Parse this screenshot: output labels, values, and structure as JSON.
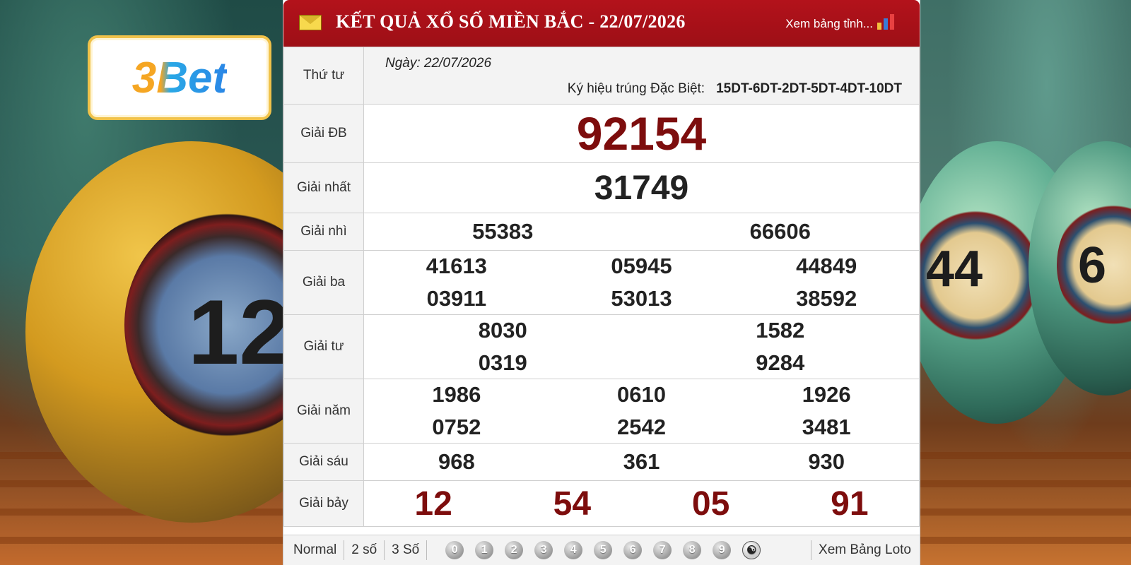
{
  "brand": {
    "logo_text": "3Bet"
  },
  "background": {
    "ball_left_number": "12",
    "ball_right_numbers": [
      "44",
      "6"
    ]
  },
  "header": {
    "title": "KẾT QUẢ XỔ SỐ MIỀN BẮC - 22/07/2026",
    "link_text": "Xem bảng tỉnh...",
    "accent_color": "#B3121B"
  },
  "info": {
    "weekday": "Thứ tư",
    "date_label": "Ngày: 22/07/2026",
    "kyhieu_label": "Ký hiệu trúng Đặc Biệt:",
    "kyhieu_value": "15DT-6DT-2DT-5DT-4DT-10DT"
  },
  "prizes": {
    "db": {
      "label": "Giải ĐB",
      "value": "92154"
    },
    "nhat": {
      "label": "Giải nhất",
      "value": "31749"
    },
    "nhi": {
      "label": "Giải nhì",
      "values": [
        "55383",
        "66606"
      ]
    },
    "ba": {
      "label": "Giải ba",
      "values": [
        "41613",
        "05945",
        "44849",
        "03911",
        "53013",
        "38592"
      ]
    },
    "tu": {
      "label": "Giải tư",
      "values": [
        "8030",
        "1582",
        "0319",
        "9284"
      ]
    },
    "nam": {
      "label": "Giải năm",
      "values": [
        "1986",
        "0610",
        "1926",
        "0752",
        "2542",
        "3481"
      ]
    },
    "sau": {
      "label": "Giải sáu",
      "values": [
        "968",
        "361",
        "930"
      ]
    },
    "bay": {
      "label": "Giải bảy",
      "values": [
        "12",
        "54",
        "05",
        "91"
      ]
    }
  },
  "footer": {
    "tabs": [
      "Normal",
      "2 số",
      "3 Số"
    ],
    "digits": [
      "0",
      "1",
      "2",
      "3",
      "4",
      "5",
      "6",
      "7",
      "8",
      "9"
    ],
    "yin_yang_icon": "yin-yang-icon",
    "loto_link": "Xem Bảng Loto"
  }
}
